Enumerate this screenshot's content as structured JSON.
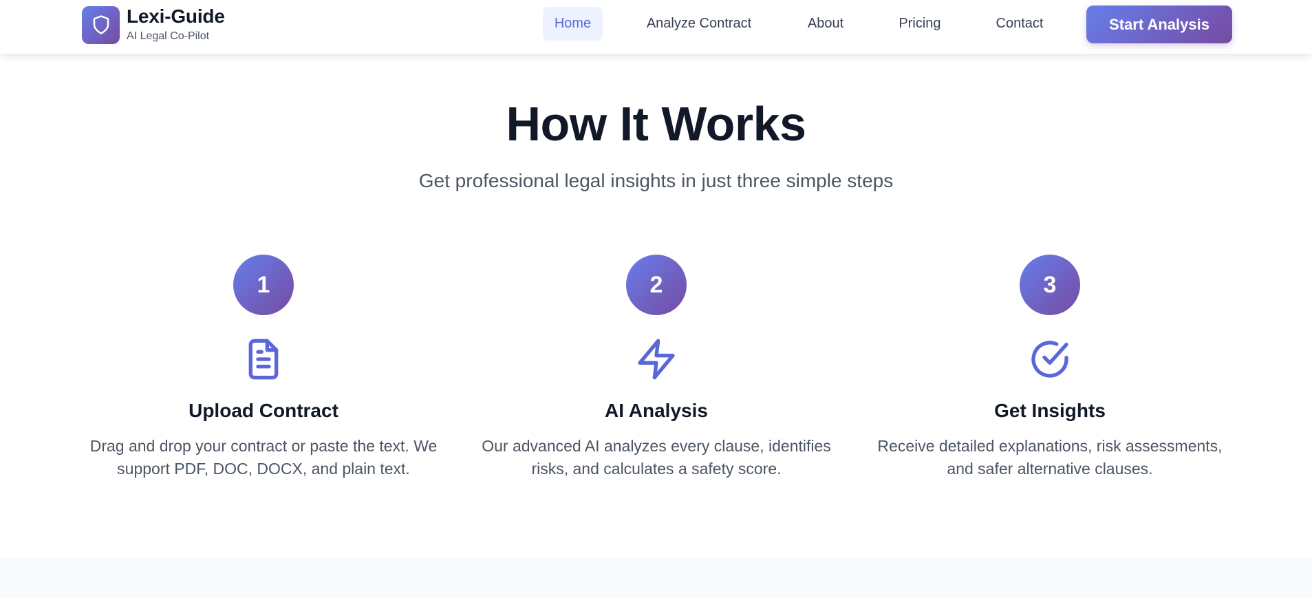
{
  "header": {
    "brand_name": "Lexi-Guide",
    "brand_tagline": "AI Legal Co-Pilot",
    "logo_icon": "shield-icon",
    "nav": [
      {
        "label": "Home",
        "active": true
      },
      {
        "label": "Analyze Contract",
        "active": false
      },
      {
        "label": "About",
        "active": false
      },
      {
        "label": "Pricing",
        "active": false
      },
      {
        "label": "Contact",
        "active": false
      }
    ],
    "cta_label": "Start Analysis"
  },
  "section": {
    "title": "How It Works",
    "subtitle": "Get professional legal insights in just three simple steps",
    "steps": [
      {
        "number": "1",
        "icon": "document-icon",
        "title": "Upload Contract",
        "description": "Drag and drop your contract or paste the text. We support PDF, DOC, DOCX, and plain text."
      },
      {
        "number": "2",
        "icon": "lightning-bolt-icon",
        "title": "AI Analysis",
        "description": "Our advanced AI analyzes every clause, identifies risks, and calculates a safety score."
      },
      {
        "number": "3",
        "icon": "check-circle-icon",
        "title": "Get Insights",
        "description": "Receive detailed explanations, risk assessments, and safer alternative clauses."
      }
    ]
  },
  "colors": {
    "accent": "#5a67d8",
    "gradient_start": "#667eea",
    "gradient_end": "#764ba2",
    "heading": "#111827",
    "body_text": "#4b5563",
    "active_nav_bg": "#eef2ff"
  }
}
